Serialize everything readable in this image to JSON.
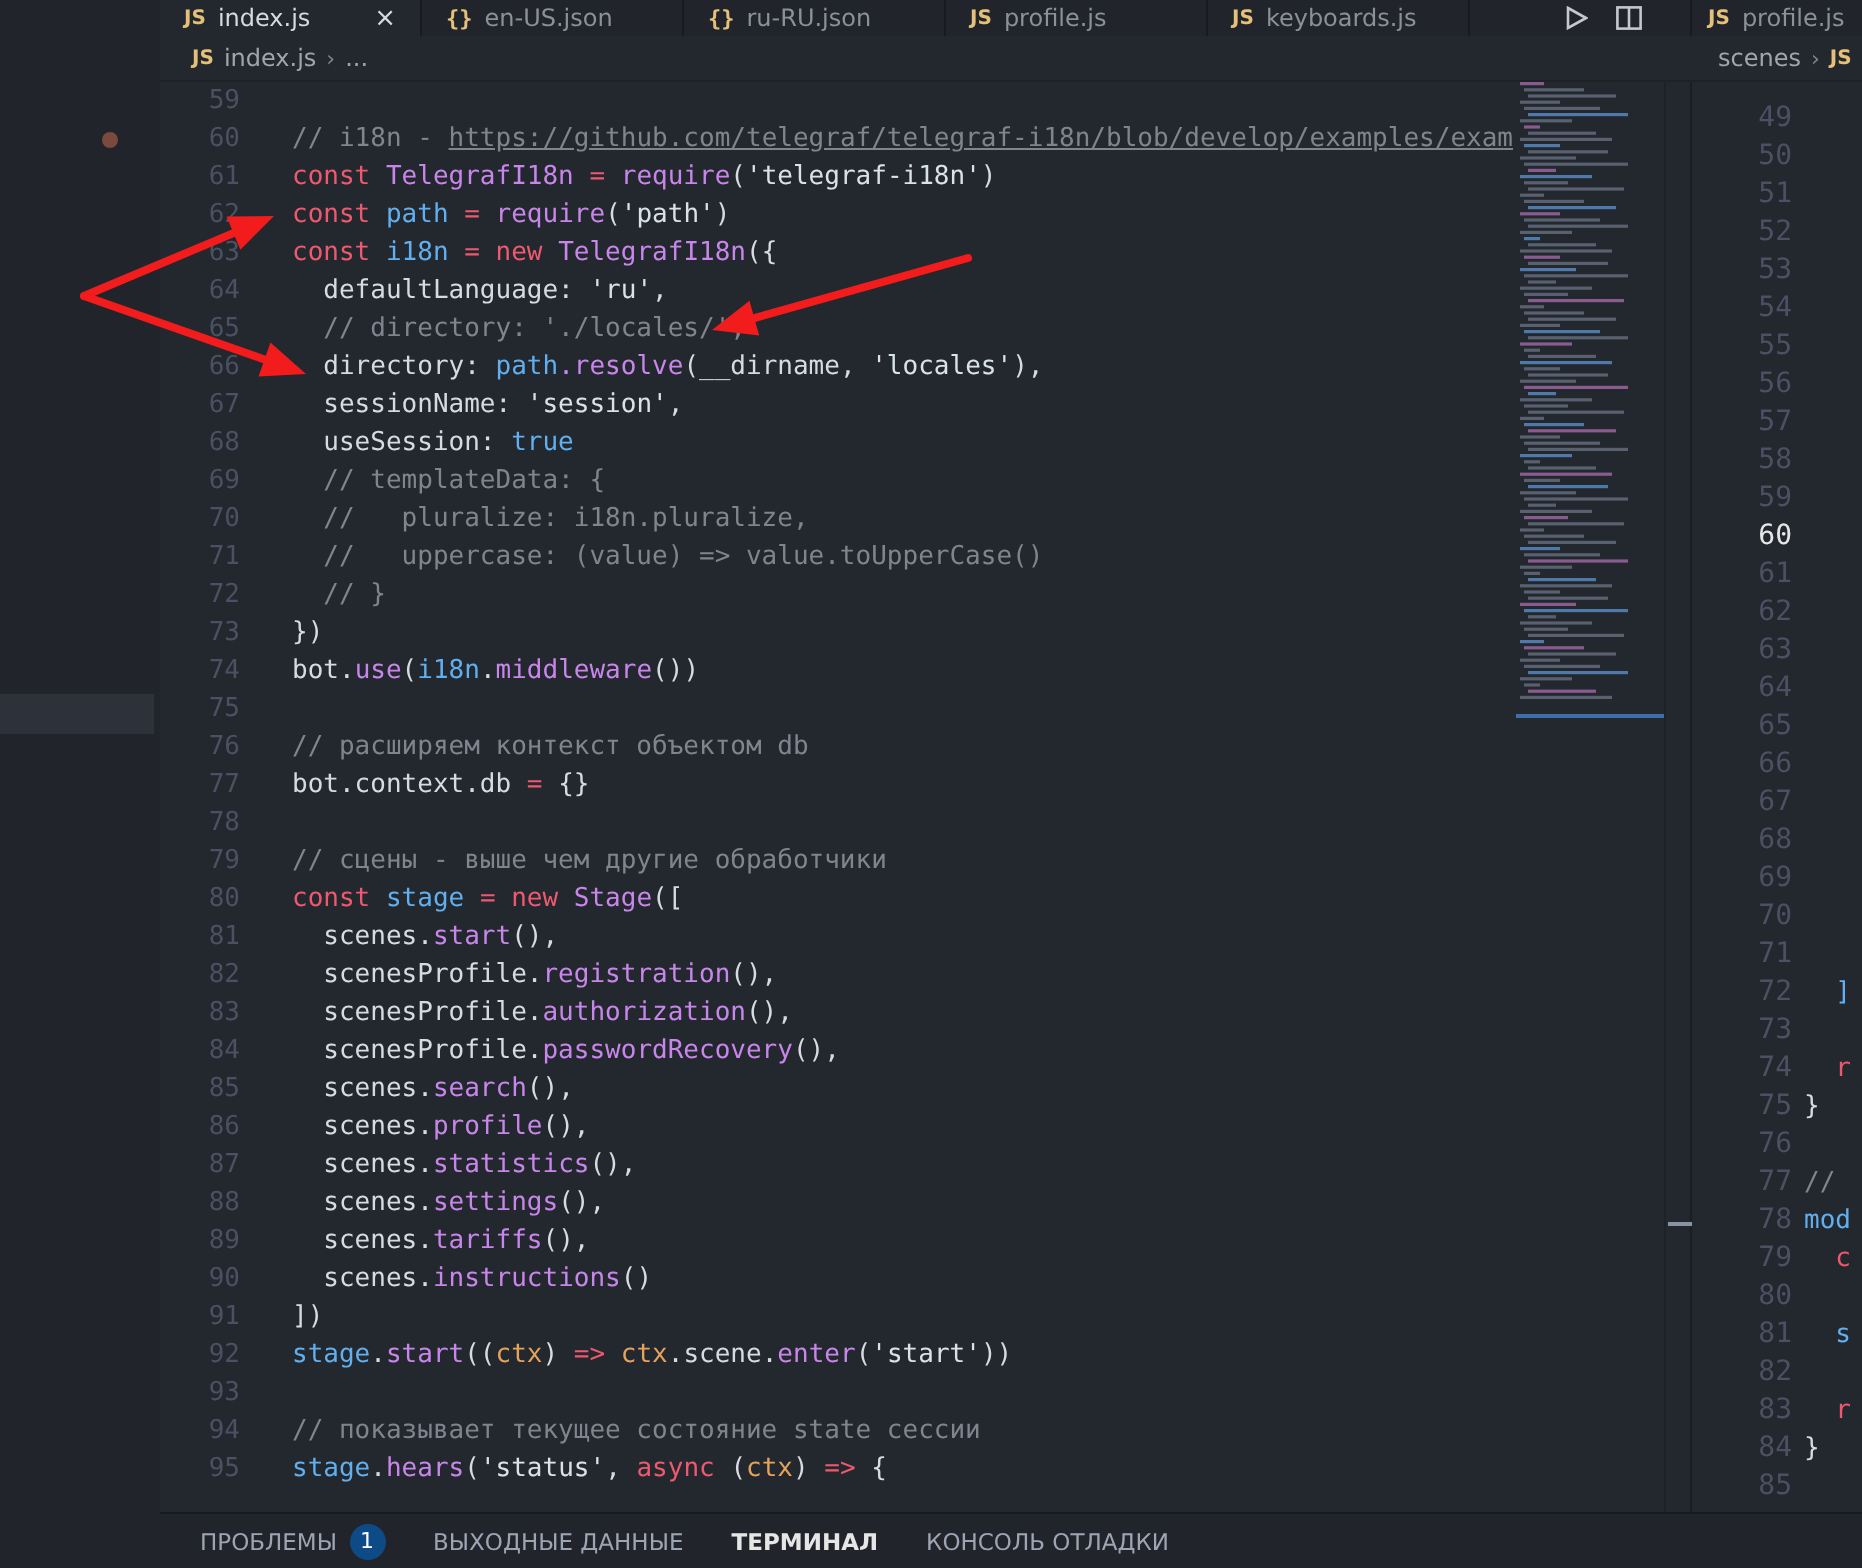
{
  "tabs": [
    {
      "icon": "JS",
      "label": "index.js",
      "selected": true,
      "close": "×"
    },
    {
      "icon": "{}",
      "label": "en-US.json",
      "selected": false
    },
    {
      "icon": "{}",
      "label": "ru-RU.json",
      "selected": false
    },
    {
      "icon": "JS",
      "label": "profile.js",
      "selected": false
    },
    {
      "icon": "JS",
      "label": "keyboards.js",
      "selected": false
    }
  ],
  "side_tab": {
    "icon": "JS",
    "label": "profile.js"
  },
  "breadcrumb": {
    "icon": "JS",
    "items": [
      "index.js",
      "..."
    ],
    "separator": "›"
  },
  "side_breadcrumb": {
    "items": [
      "scenes"
    ],
    "separator": "›",
    "icon": "JS"
  },
  "editor": {
    "lines": [
      {
        "number": "59"
      },
      {
        "number": "60",
        "tokens": [
          {
            "text": "// i18n - ",
            "kind": "comment"
          },
          {
            "text": "https://github.com/telegraf/telegraf-i18n/blob/develop/examples/exam",
            "kind": "link"
          }
        ]
      },
      {
        "number": "61",
        "tokens": [
          {
            "text": "const ",
            "kind": "keyword"
          },
          {
            "text": "TelegrafI18n ",
            "kind": "function"
          },
          {
            "text": "= ",
            "kind": "keyword"
          },
          {
            "text": "require",
            "kind": "function"
          },
          {
            "text": "(",
            "kind": "plain"
          },
          {
            "text": "'telegraf-i18n'",
            "kind": "string"
          },
          {
            "text": ")",
            "kind": "plain"
          }
        ]
      },
      {
        "number": "62",
        "tokens": [
          {
            "text": "const ",
            "kind": "keyword"
          },
          {
            "text": "path ",
            "kind": "variable"
          },
          {
            "text": "= ",
            "kind": "keyword"
          },
          {
            "text": "require",
            "kind": "function"
          },
          {
            "text": "(",
            "kind": "plain"
          },
          {
            "text": "'path'",
            "kind": "string"
          },
          {
            "text": ")",
            "kind": "plain"
          }
        ]
      },
      {
        "number": "63",
        "tokens": [
          {
            "text": "const ",
            "kind": "keyword"
          },
          {
            "text": "i18n ",
            "kind": "variable"
          },
          {
            "text": "= ",
            "kind": "keyword"
          },
          {
            "text": "new ",
            "kind": "keyword"
          },
          {
            "text": "TelegrafI18n",
            "kind": "function"
          },
          {
            "text": "({",
            "kind": "plain"
          }
        ]
      },
      {
        "number": "64",
        "tokens": [
          {
            "text": "  defaultLanguage: ",
            "kind": "plain"
          },
          {
            "text": "'ru'",
            "kind": "string"
          },
          {
            "text": ",",
            "kind": "plain"
          }
        ]
      },
      {
        "number": "65",
        "tokens": [
          {
            "text": "  // directory: './locales/',",
            "kind": "comment"
          }
        ]
      },
      {
        "number": "66",
        "tokens": [
          {
            "text": "  directory: ",
            "kind": "plain"
          },
          {
            "text": "path",
            "kind": "variable"
          },
          {
            "text": ".resolve",
            "kind": "function"
          },
          {
            "text": "(__dirname, ",
            "kind": "plain"
          },
          {
            "text": "'locales'",
            "kind": "string"
          },
          {
            "text": "),",
            "kind": "plain"
          }
        ]
      },
      {
        "number": "67",
        "tokens": [
          {
            "text": "  sessionName: ",
            "kind": "plain"
          },
          {
            "text": "'session'",
            "kind": "string"
          },
          {
            "text": ",",
            "kind": "plain"
          }
        ]
      },
      {
        "number": "68",
        "tokens": [
          {
            "text": "  useSession: ",
            "kind": "plain"
          },
          {
            "text": "true",
            "kind": "variable"
          }
        ]
      },
      {
        "number": "69",
        "tokens": [
          {
            "text": "  // templateData: {",
            "kind": "comment"
          }
        ]
      },
      {
        "number": "70",
        "tokens": [
          {
            "text": "  //   pluralize: i18n.pluralize,",
            "kind": "comment"
          }
        ]
      },
      {
        "number": "71",
        "tokens": [
          {
            "text": "  //   uppercase: (value) => value.toUpperCase()",
            "kind": "comment"
          }
        ]
      },
      {
        "number": "72",
        "tokens": [
          {
            "text": "  // }",
            "kind": "comment"
          }
        ]
      },
      {
        "number": "73",
        "tokens": [
          {
            "text": "})",
            "kind": "plain"
          }
        ]
      },
      {
        "number": "74",
        "tokens": [
          {
            "text": "bot.",
            "kind": "plain"
          },
          {
            "text": "use",
            "kind": "function"
          },
          {
            "text": "(",
            "kind": "plain"
          },
          {
            "text": "i18n",
            "kind": "variable"
          },
          {
            "text": ".",
            "kind": "plain"
          },
          {
            "text": "middleware",
            "kind": "function"
          },
          {
            "text": "())",
            "kind": "plain"
          }
        ]
      },
      {
        "number": "75"
      },
      {
        "number": "76",
        "tokens": [
          {
            "text": "// расширяем контекст объектом db",
            "kind": "comment"
          }
        ]
      },
      {
        "number": "77",
        "tokens": [
          {
            "text": "bot.context.db ",
            "kind": "plain"
          },
          {
            "text": "= ",
            "kind": "keyword"
          },
          {
            "text": "{}",
            "kind": "plain"
          }
        ]
      },
      {
        "number": "78"
      },
      {
        "number": "79",
        "tokens": [
          {
            "text": "// сцены - выше чем другие обработчики",
            "kind": "comment"
          }
        ]
      },
      {
        "number": "80",
        "tokens": [
          {
            "text": "const ",
            "kind": "keyword"
          },
          {
            "text": "stage ",
            "kind": "variable"
          },
          {
            "text": "= ",
            "kind": "keyword"
          },
          {
            "text": "new ",
            "kind": "keyword"
          },
          {
            "text": "Stage",
            "kind": "function"
          },
          {
            "text": "([",
            "kind": "plain"
          }
        ]
      },
      {
        "number": "81",
        "tokens": [
          {
            "text": "  scenes.",
            "kind": "plain"
          },
          {
            "text": "start",
            "kind": "function"
          },
          {
            "text": "(),",
            "kind": "plain"
          }
        ]
      },
      {
        "number": "82",
        "tokens": [
          {
            "text": "  scenesProfile.",
            "kind": "plain"
          },
          {
            "text": "registration",
            "kind": "function"
          },
          {
            "text": "(),",
            "kind": "plain"
          }
        ]
      },
      {
        "number": "83",
        "tokens": [
          {
            "text": "  scenesProfile.",
            "kind": "plain"
          },
          {
            "text": "authorization",
            "kind": "function"
          },
          {
            "text": "(),",
            "kind": "plain"
          }
        ]
      },
      {
        "number": "84",
        "tokens": [
          {
            "text": "  scenesProfile.",
            "kind": "plain"
          },
          {
            "text": "passwordRecovery",
            "kind": "function"
          },
          {
            "text": "(),",
            "kind": "plain"
          }
        ]
      },
      {
        "number": "85",
        "tokens": [
          {
            "text": "  scenes.",
            "kind": "plain"
          },
          {
            "text": "search",
            "kind": "function"
          },
          {
            "text": "(),",
            "kind": "plain"
          }
        ]
      },
      {
        "number": "86",
        "tokens": [
          {
            "text": "  scenes.",
            "kind": "plain"
          },
          {
            "text": "profile",
            "kind": "function"
          },
          {
            "text": "(),",
            "kind": "plain"
          }
        ]
      },
      {
        "number": "87",
        "tokens": [
          {
            "text": "  scenes.",
            "kind": "plain"
          },
          {
            "text": "statistics",
            "kind": "function"
          },
          {
            "text": "(),",
            "kind": "plain"
          }
        ]
      },
      {
        "number": "88",
        "tokens": [
          {
            "text": "  scenes.",
            "kind": "plain"
          },
          {
            "text": "settings",
            "kind": "function"
          },
          {
            "text": "(),",
            "kind": "plain"
          }
        ]
      },
      {
        "number": "89",
        "tokens": [
          {
            "text": "  scenes.",
            "kind": "plain"
          },
          {
            "text": "tariffs",
            "kind": "function"
          },
          {
            "text": "(),",
            "kind": "plain"
          }
        ]
      },
      {
        "number": "90",
        "tokens": [
          {
            "text": "  scenes.",
            "kind": "plain"
          },
          {
            "text": "instructions",
            "kind": "function"
          },
          {
            "text": "()",
            "kind": "plain"
          }
        ]
      },
      {
        "number": "91",
        "tokens": [
          {
            "text": "])",
            "kind": "plain"
          }
        ]
      },
      {
        "number": "92",
        "tokens": [
          {
            "text": "stage",
            "kind": "variable"
          },
          {
            "text": ".",
            "kind": "plain"
          },
          {
            "text": "start",
            "kind": "function"
          },
          {
            "text": "((",
            "kind": "plain"
          },
          {
            "text": "ctx",
            "kind": "param"
          },
          {
            "text": ") ",
            "kind": "plain"
          },
          {
            "text": "=> ",
            "kind": "keyword"
          },
          {
            "text": "ctx",
            "kind": "param"
          },
          {
            "text": ".scene.",
            "kind": "plain"
          },
          {
            "text": "enter",
            "kind": "function"
          },
          {
            "text": "(",
            "kind": "plain"
          },
          {
            "text": "'start'",
            "kind": "string"
          },
          {
            "text": "))",
            "kind": "plain"
          }
        ]
      },
      {
        "number": "93"
      },
      {
        "number": "94",
        "tokens": [
          {
            "text": "// показывает текущее состояние state сессии",
            "kind": "comment"
          }
        ]
      },
      {
        "number": "95",
        "tokens": [
          {
            "text": "stage",
            "kind": "variable"
          },
          {
            "text": ".",
            "kind": "plain"
          },
          {
            "text": "hears",
            "kind": "function"
          },
          {
            "text": "(",
            "kind": "plain"
          },
          {
            "text": "'status'",
            "kind": "string"
          },
          {
            "text": ", ",
            "kind": "plain"
          },
          {
            "text": "async ",
            "kind": "keyword"
          },
          {
            "text": "(",
            "kind": "plain"
          },
          {
            "text": "ctx",
            "kind": "param"
          },
          {
            "text": ") ",
            "kind": "plain"
          },
          {
            "text": "=> ",
            "kind": "keyword"
          },
          {
            "text": "{",
            "kind": "plain"
          }
        ]
      }
    ]
  },
  "side_editor": {
    "lines": [
      {
        "number": "49",
        "selected": false
      },
      {
        "number": "50",
        "selected": false
      },
      {
        "number": "51",
        "selected": false
      },
      {
        "number": "52",
        "selected": false
      },
      {
        "number": "53",
        "selected": false
      },
      {
        "number": "54",
        "selected": false
      },
      {
        "number": "55",
        "selected": false
      },
      {
        "number": "56",
        "selected": false
      },
      {
        "number": "57",
        "selected": false
      },
      {
        "number": "58",
        "selected": false
      },
      {
        "number": "59",
        "selected": false
      },
      {
        "number": "60",
        "selected": true
      },
      {
        "number": "61",
        "selected": false
      },
      {
        "number": "62",
        "selected": false
      },
      {
        "number": "63",
        "selected": false
      },
      {
        "number": "64",
        "selected": false
      },
      {
        "number": "65",
        "selected": false
      },
      {
        "number": "66",
        "selected": false
      },
      {
        "number": "67",
        "selected": false
      },
      {
        "number": "68",
        "selected": false
      },
      {
        "number": "69",
        "selected": false
      },
      {
        "number": "70",
        "selected": false
      },
      {
        "number": "71",
        "selected": false
      },
      {
        "number": "72",
        "selected": false,
        "tokens": [
          {
            "text": "  ]",
            "kind": "variable"
          }
        ]
      },
      {
        "number": "73",
        "selected": false
      },
      {
        "number": "74",
        "selected": false,
        "tokens": [
          {
            "text": "  r",
            "kind": "keyword"
          }
        ]
      },
      {
        "number": "75",
        "selected": false,
        "tokens": [
          {
            "text": "}",
            "kind": "plain"
          }
        ]
      },
      {
        "number": "76",
        "selected": false
      },
      {
        "number": "77",
        "selected": false,
        "tokens": [
          {
            "text": "//",
            "kind": "comment"
          }
        ]
      },
      {
        "number": "78",
        "selected": false,
        "tokens": [
          {
            "text": "mod",
            "kind": "variable"
          }
        ]
      },
      {
        "number": "79",
        "selected": false,
        "tokens": [
          {
            "text": "  c",
            "kind": "keyword"
          }
        ]
      },
      {
        "number": "80",
        "selected": false
      },
      {
        "number": "81",
        "selected": false,
        "tokens": [
          {
            "text": "  s",
            "kind": "variable"
          }
        ]
      },
      {
        "number": "82",
        "selected": false
      },
      {
        "number": "83",
        "selected": false,
        "tokens": [
          {
            "text": "  r",
            "kind": "keyword"
          }
        ]
      },
      {
        "number": "84",
        "selected": false,
        "tokens": [
          {
            "text": "}",
            "kind": "plain"
          }
        ]
      },
      {
        "number": "85",
        "selected": false
      }
    ]
  },
  "panel_tabs": [
    {
      "label": "ПРОБЛЕМЫ",
      "badge": "1",
      "selected": false
    },
    {
      "label": "ВЫХОДНЫЕ ДАННЫЕ",
      "selected": false
    },
    {
      "label": "ТЕРМИНАЛ",
      "selected": true
    },
    {
      "label": "КОНСОЛЬ ОТЛАДКИ",
      "selected": false
    }
  ]
}
